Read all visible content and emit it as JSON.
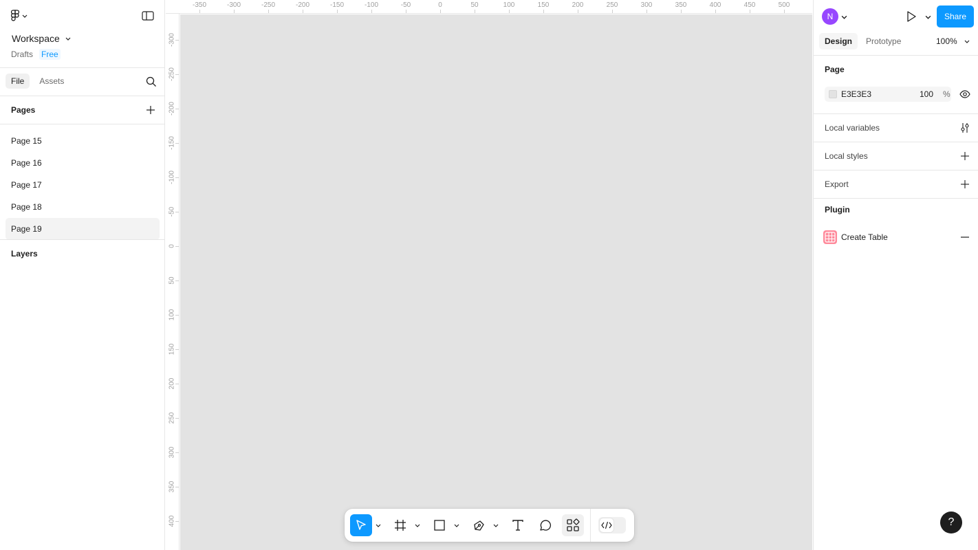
{
  "left_panel": {
    "workspace_name": "Workspace",
    "drafts_label": "Drafts",
    "plan_badge": "Free",
    "tabs": [
      {
        "label": "File",
        "active": true
      },
      {
        "label": "Assets",
        "active": false
      }
    ],
    "pages_header": "Pages",
    "pages": [
      {
        "label": "Page 15",
        "selected": false
      },
      {
        "label": "Page 16",
        "selected": false
      },
      {
        "label": "Page 17",
        "selected": false
      },
      {
        "label": "Page 18",
        "selected": false
      },
      {
        "label": "Page 19",
        "selected": true
      }
    ],
    "layers_header": "Layers"
  },
  "rulers": {
    "top_labels": [
      "-350",
      "-300",
      "-250",
      "-200",
      "-150",
      "-100",
      "-50",
      "0",
      "50",
      "100",
      "150",
      "200",
      "250",
      "300",
      "350",
      "400",
      "450",
      "500"
    ],
    "left_labels": [
      "-300",
      "-250",
      "-200",
      "-150",
      "-100",
      "-50",
      "0",
      "50",
      "100",
      "150",
      "200",
      "250",
      "300",
      "350",
      "400"
    ]
  },
  "canvas": {
    "background": "#E3E3E3"
  },
  "toolbar": {
    "tools": [
      {
        "name": "move-tool",
        "icon": "cursor-icon",
        "active": true
      },
      {
        "name": "frame-tool",
        "icon": "frame-hash-icon"
      },
      {
        "name": "shape-tool",
        "icon": "rectangle-icon"
      },
      {
        "name": "pen-tool",
        "icon": "pen-icon"
      },
      {
        "name": "text-tool",
        "icon": "text-icon"
      },
      {
        "name": "comment-tool",
        "icon": "comment-icon"
      },
      {
        "name": "actions-tool",
        "icon": "actions-icon"
      }
    ],
    "dev_mode_icon": "code-icon"
  },
  "right_panel": {
    "avatar_initial": "N",
    "share_label": "Share",
    "tabs": [
      {
        "label": "Design",
        "active": true
      },
      {
        "label": "Prototype",
        "active": false
      }
    ],
    "zoom": "100%",
    "page_section": {
      "header": "Page",
      "fill_hex": "E3E3E3",
      "fill_opacity": "100",
      "percent_sign": "%",
      "fill_color": "#E3E3E3"
    },
    "local_variables": "Local variables",
    "local_styles": "Local styles",
    "export": "Export",
    "plugin_header": "Plugin",
    "plugin_name": "Create Table",
    "help": "?"
  },
  "colors": {
    "accent": "#0D99FF",
    "avatar": "#9747FF",
    "plugin_icon": "#FF8A9B"
  }
}
